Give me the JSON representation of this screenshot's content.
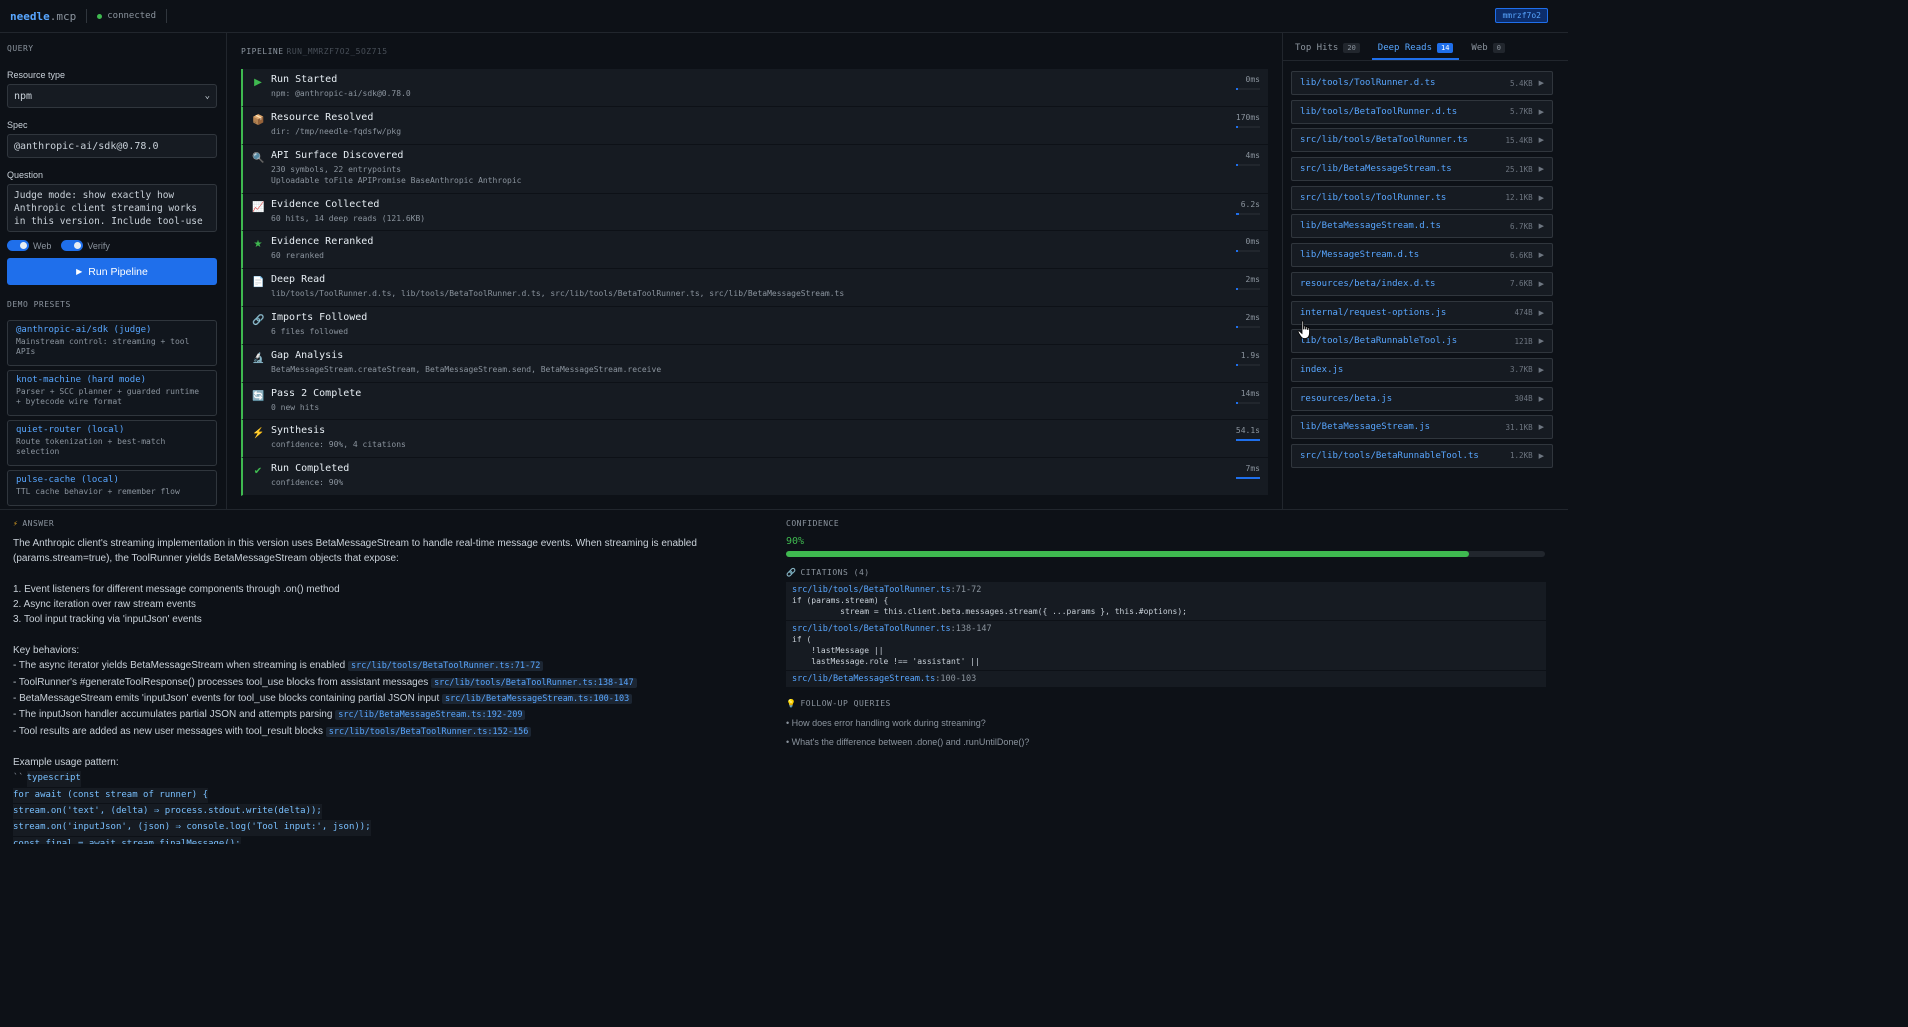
{
  "app": {
    "brand_main": "needle",
    "brand_suffix": ".mcp",
    "status": "connected",
    "run_badge": "mmrzf7o2"
  },
  "query": {
    "section_title": "QUERY",
    "resource_type_label": "Resource type",
    "resource_type_value": "npm",
    "spec_label": "Spec",
    "spec_value": "@anthropic-ai/sdk@0.78.0",
    "question_label": "Question",
    "question_value": "Judge mode: show exactly how Anthropic client streaming works in this version. Include tool-use",
    "toggle_web": "Web",
    "toggle_verify": "Verify",
    "run_button": "Run Pipeline",
    "presets_title": "DEMO PRESETS",
    "presets": [
      {
        "name": "@anthropic-ai/sdk (judge)",
        "desc": "Mainstream control: streaming + tool APIs"
      },
      {
        "name": "knot-machine (hard mode)",
        "desc": "Parser + SCC planner + guarded runtime + bytecode wire format"
      },
      {
        "name": "quiet-router (local)",
        "desc": "Route tokenization + best-match selection"
      },
      {
        "name": "pulse-cache (local)",
        "desc": "TTL cache behavior + remember flow"
      }
    ]
  },
  "pipeline": {
    "title": "PIPELINE",
    "run_id": "RUN_MMRZF7O2_5OZ715",
    "steps": [
      {
        "icon": "▶",
        "title": "Run Started",
        "sub": "npm: @anthropic-ai/sdk@0.78.0",
        "sub2": "",
        "time": "0ms",
        "progress": 0.1
      },
      {
        "icon": "📦",
        "title": "Resource Resolved",
        "sub": "dir: /tmp/needle-fqdsfw/pkg",
        "sub2": "",
        "time": "170ms",
        "progress": 0.1
      },
      {
        "icon": "🔍",
        "title": "API Surface Discovered",
        "sub": "230 symbols, 22 entrypoints",
        "sub2": "Uploadable toFile APIPromise BaseAnthropic Anthropic",
        "time": "4ms",
        "progress": 0.1
      },
      {
        "icon": "📈",
        "title": "Evidence Collected",
        "sub": "60 hits, 14 deep reads (121.6KB)",
        "sub2": "",
        "time": "6.2s",
        "progress": 0.12
      },
      {
        "icon": "★",
        "title": "Evidence Reranked",
        "sub": "60 reranked",
        "sub2": "",
        "time": "0ms",
        "progress": 0.1
      },
      {
        "icon": "📄",
        "title": "Deep Read",
        "sub": "lib/tools/ToolRunner.d.ts, lib/tools/BetaToolRunner.d.ts, src/lib/tools/BetaToolRunner.ts, src/lib/BetaMessageStream.ts",
        "sub2": "",
        "time": "2ms",
        "progress": 0.1
      },
      {
        "icon": "🔗",
        "title": "Imports Followed",
        "sub": "6 files followed",
        "sub2": "",
        "time": "2ms",
        "progress": 0.1
      },
      {
        "icon": "🔬",
        "title": "Gap Analysis",
        "sub": "BetaMessageStream.createStream, BetaMessageStream.send, BetaMessageStream.receive",
        "sub2": "",
        "time": "1.9s",
        "progress": 0.1
      },
      {
        "icon": "🔄",
        "title": "Pass 2 Complete",
        "sub": "0 new hits",
        "sub2": "",
        "time": "14ms",
        "progress": 0.1
      },
      {
        "icon": "⚡",
        "title": "Synthesis",
        "sub": "confidence: 90%, 4 citations",
        "sub2": "",
        "time": "54.1s",
        "progress": 1.0
      },
      {
        "icon": "✔",
        "title": "Run Completed",
        "sub": "confidence: 90%",
        "sub2": "",
        "time": "7ms",
        "progress": 1.0
      }
    ]
  },
  "results": {
    "tabs": [
      {
        "label": "Top Hits",
        "count": "20"
      },
      {
        "label": "Deep Reads",
        "count": "14"
      },
      {
        "label": "Web",
        "count": "0"
      }
    ],
    "files": [
      {
        "name": "lib/tools/ToolRunner.d.ts",
        "size": "5.4KB"
      },
      {
        "name": "lib/tools/BetaToolRunner.d.ts",
        "size": "5.7KB"
      },
      {
        "name": "src/lib/tools/BetaToolRunner.ts",
        "size": "15.4KB"
      },
      {
        "name": "src/lib/BetaMessageStream.ts",
        "size": "25.1KB"
      },
      {
        "name": "src/lib/tools/ToolRunner.ts",
        "size": "12.1KB"
      },
      {
        "name": "lib/BetaMessageStream.d.ts",
        "size": "6.7KB"
      },
      {
        "name": "lib/MessageStream.d.ts",
        "size": "6.6KB"
      },
      {
        "name": "resources/beta/index.d.ts",
        "size": "7.6KB"
      },
      {
        "name": "internal/request-options.js",
        "size": "474B"
      },
      {
        "name": "lib/tools/BetaRunnableTool.js",
        "size": "121B"
      },
      {
        "name": "index.js",
        "size": "3.7KB"
      },
      {
        "name": "resources/beta.js",
        "size": "304B"
      },
      {
        "name": "lib/BetaMessageStream.js",
        "size": "31.1KB"
      },
      {
        "name": "src/lib/tools/BetaRunnableTool.ts",
        "size": "1.2KB"
      }
    ]
  },
  "answer": {
    "title": "ANSWER",
    "intro": "The Anthropic client's streaming implementation in this version uses BetaMessageStream to handle real-time message events. When streaming is enabled (params.stream=true), the ToolRunner yields BetaMessageStream objects that expose:",
    "points": [
      "1. Event listeners for different message components through .on() method",
      "2. Async iteration over raw stream events",
      "3. Tool input tracking via 'inputJson' events"
    ],
    "key_title": "Key behaviors:",
    "behaviors": [
      {
        "text": "- The async iterator yields BetaMessageStream when streaming is enabled",
        "cite": "src/lib/tools/BetaToolRunner.ts:71-72"
      },
      {
        "text": "- ToolRunner's #generateToolResponse() processes tool_use blocks from assistant messages",
        "cite": "src/lib/tools/BetaToolRunner.ts:138-147"
      },
      {
        "text": "- BetaMessageStream emits 'inputJson' events for tool_use blocks containing partial JSON input",
        "cite": "src/lib/BetaMessageStream.ts:100-103"
      },
      {
        "text": "- The inputJson handler accumulates partial JSON and attempts parsing",
        "cite": "src/lib/BetaMessageStream.ts:192-209"
      },
      {
        "text": "- Tool results are added as new user messages with tool_result blocks",
        "cite": "src/lib/tools/BetaToolRunner.ts:152-156"
      }
    ],
    "example_title": "Example usage pattern:",
    "code_fence": "``",
    "code_lang": "typescript",
    "code_lines": [
      "for await (const stream of runner) {",
      "stream.on('text', (delta) ⇒ process.stdout.write(delta));",
      "stream.on('inputJson', (json) ⇒ console.log('Tool input:', json));",
      "const final = await stream.finalMessage();"
    ]
  },
  "confidence": {
    "title": "CONFIDENCE",
    "value": "90%",
    "fraction": 0.9,
    "citations_title": "CITATIONS (4)",
    "citations": [
      {
        "file": "src/lib/tools/BetaToolRunner.ts",
        "lines": ":71-72",
        "code": "if (params.stream) {\n          stream = this.client.beta.messages.stream({ ...params }, this.#options);"
      },
      {
        "file": "src/lib/tools/BetaToolRunner.ts",
        "lines": ":138-147",
        "code": "if (\n    !lastMessage ||\n    lastMessage.role !== 'assistant' ||"
      },
      {
        "file": "src/lib/BetaMessageStream.ts",
        "lines": ":100-103",
        "code": ""
      }
    ],
    "followup_title": "FOLLOW-UP QUERIES",
    "followups": [
      "• How does error handling work during streaming?",
      "• What's the difference between .done() and .runUntilDone()?"
    ]
  }
}
